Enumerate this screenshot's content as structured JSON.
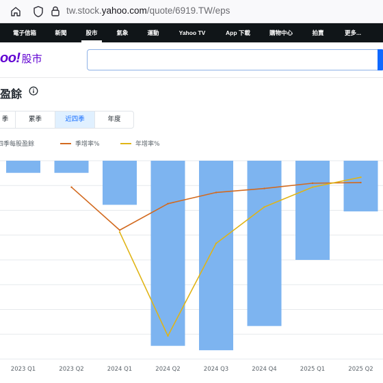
{
  "browser": {
    "url_prefix": "tw.stock.",
    "url_host": "yahoo.com",
    "url_path": "/quote/6919.TW/eps"
  },
  "topnav": {
    "items": [
      "電子信箱",
      "新聞",
      "股市",
      "氣象",
      "運動",
      "Yahoo TV",
      "App 下載",
      "購物中心",
      "拍賣",
      "更多..."
    ],
    "active_index": 2
  },
  "header": {
    "logo_brand": "oo!",
    "logo_product": "股市",
    "search_value": ""
  },
  "page": {
    "title": "盈餘"
  },
  "tabs": {
    "items": [
      "季",
      "累季",
      "近四季",
      "年度"
    ],
    "active_index": 2
  },
  "legend": {
    "items": [
      {
        "label": "四季每股盈餘",
        "color": "#7db4f0"
      },
      {
        "label": "季增率%",
        "color": "#d2691e"
      },
      {
        "label": "年增率%",
        "color": "#e0b415"
      }
    ]
  },
  "colors": {
    "bar": "#7db4f0",
    "qoq": "#d2691e",
    "yoy": "#e0b415",
    "nav_bg": "#101518",
    "brand": "#6001d2"
  },
  "chart_data": {
    "type": "bar",
    "categories": [
      "2023 Q1",
      "2023 Q2",
      "2024 Q1",
      "2024 Q2",
      "2024 Q3",
      "2024 Q4",
      "2025 Q1",
      "2025 Q2"
    ],
    "series": [
      {
        "name": "四季每股盈餘",
        "type": "bar",
        "values": [
          -0.55,
          -0.55,
          -2.0,
          -8.4,
          -8.6,
          -7.5,
          -4.5,
          -2.3
        ]
      },
      {
        "name": "季增率%",
        "type": "line",
        "values": [
          null,
          8.0,
          1.5,
          5.5,
          7.2,
          7.8,
          8.6,
          8.7
        ]
      },
      {
        "name": "年增率%",
        "type": "line",
        "values": [
          null,
          null,
          1.2,
          -14.5,
          -0.5,
          5.0,
          8.0,
          9.5
        ]
      }
    ],
    "grid": true,
    "legend": "top-left"
  }
}
